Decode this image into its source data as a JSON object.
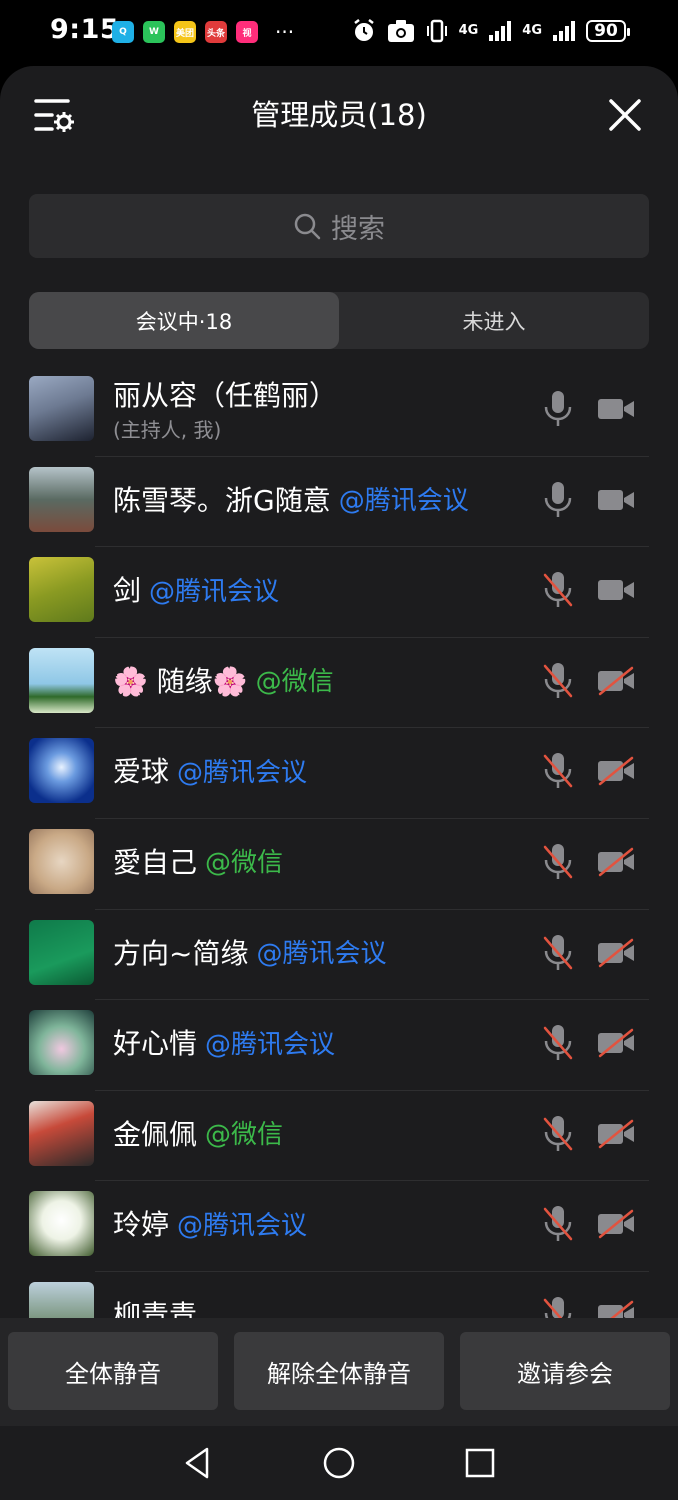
{
  "status_bar": {
    "time": "9:15",
    "app_icons": [
      {
        "name": "qq-icon",
        "label": "Q",
        "color": "#1fb0e6"
      },
      {
        "name": "wechat-icon",
        "label": "W",
        "color": "#2bc35a"
      },
      {
        "name": "meituan-icon",
        "label": "美团",
        "color": "#f5c518"
      },
      {
        "name": "toutiao-icon",
        "label": "头条",
        "color": "#e03b3b"
      },
      {
        "name": "video-app-icon",
        "label": "视",
        "color": "#ff2d7a"
      }
    ],
    "more": "···",
    "net1": "4G",
    "net2": "4G",
    "battery": "90"
  },
  "header": {
    "title": "管理成员(18)"
  },
  "search": {
    "placeholder": "搜索"
  },
  "tabs": [
    {
      "label": "会议中·18",
      "active": true
    },
    {
      "label": "未进入",
      "active": false
    }
  ],
  "members": [
    {
      "name": "丽从容（任鹤丽）",
      "sub": "(主持人, 我)",
      "tag": "",
      "tag_type": "",
      "mic_on": true,
      "cam_on": true
    },
    {
      "name": "陈雪琴。浙G随意",
      "sub": "",
      "tag": "@腾讯会议",
      "tag_type": "tencent",
      "mic_on": true,
      "cam_on": true
    },
    {
      "name": "剑",
      "sub": "",
      "tag": "@腾讯会议",
      "tag_type": "tencent",
      "mic_on": false,
      "cam_on": true
    },
    {
      "name": "🌸 随缘🌸",
      "sub": "",
      "tag": "@微信",
      "tag_type": "wechat",
      "mic_on": false,
      "cam_on": false
    },
    {
      "name": "爱球",
      "sub": "",
      "tag": "@腾讯会议",
      "tag_type": "tencent",
      "mic_on": false,
      "cam_on": false
    },
    {
      "name": "愛自己",
      "sub": "",
      "tag": "@微信",
      "tag_type": "wechat",
      "mic_on": false,
      "cam_on": false
    },
    {
      "name": "方向~简缘",
      "sub": "",
      "tag": "@腾讯会议",
      "tag_type": "tencent",
      "mic_on": false,
      "cam_on": false
    },
    {
      "name": "好心情",
      "sub": "",
      "tag": "@腾讯会议",
      "tag_type": "tencent",
      "mic_on": false,
      "cam_on": false
    },
    {
      "name": "金佩佩",
      "sub": "",
      "tag": "@微信",
      "tag_type": "wechat",
      "mic_on": false,
      "cam_on": false
    },
    {
      "name": "玲婷",
      "sub": "",
      "tag": "@腾讯会议",
      "tag_type": "tencent",
      "mic_on": false,
      "cam_on": false
    },
    {
      "name": "柳青青",
      "sub": "",
      "tag": "",
      "tag_type": "",
      "mic_on": false,
      "cam_on": false
    }
  ],
  "bottom_buttons": {
    "mute_all": "全体静音",
    "unmute_all": "解除全体静音",
    "invite": "邀请参会"
  },
  "colors": {
    "tencent_tag": "#2e7bf0",
    "wechat_tag": "#3cb94a",
    "muted_slash": "#e2533f",
    "icon_gray": "#8a8a8e"
  }
}
